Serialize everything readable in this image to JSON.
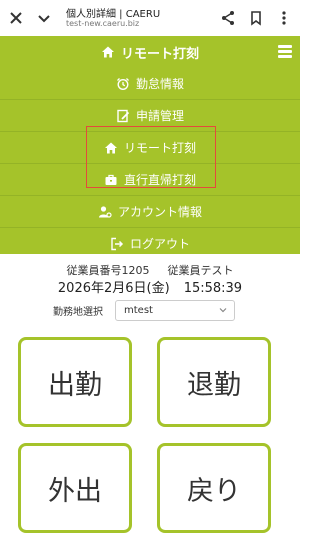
{
  "browser": {
    "title": "個人別詳細 | CAERU",
    "url": "test-new.caeru.biz",
    "icons": [
      "close-icon",
      "chevron-down-icon",
      "share-icon",
      "bookmark-icon",
      "more-vert-icon"
    ]
  },
  "header": {
    "title": "リモート打刻",
    "icon": "home-icon",
    "menu_icon": "hamburger-icon"
  },
  "menu": {
    "items": [
      {
        "label": "勤怠情報",
        "icon": "alarm-clock-icon"
      },
      {
        "label": "申請管理",
        "icon": "edit-document-icon"
      },
      {
        "label": "リモート打刻",
        "icon": "home-icon"
      },
      {
        "label": "直行直帰打刻",
        "icon": "briefcase-icon"
      },
      {
        "label": "アカウント情報",
        "icon": "user-gear-icon"
      },
      {
        "label": "ログアウト",
        "icon": "logout-icon"
      }
    ]
  },
  "employee": {
    "number": "従業員番号1205",
    "name": "従業員テスト",
    "date": "2026年2月6日(金)",
    "time": "15:58:39"
  },
  "location": {
    "label": "勤務地選択",
    "value": "mtest"
  },
  "buttons": {
    "clock_in": "出勤",
    "clock_out": "退勤",
    "go_out": "外出",
    "return": "戻り"
  },
  "colors": {
    "accent": "#a5c32a",
    "highlight": "#e44b3b"
  }
}
